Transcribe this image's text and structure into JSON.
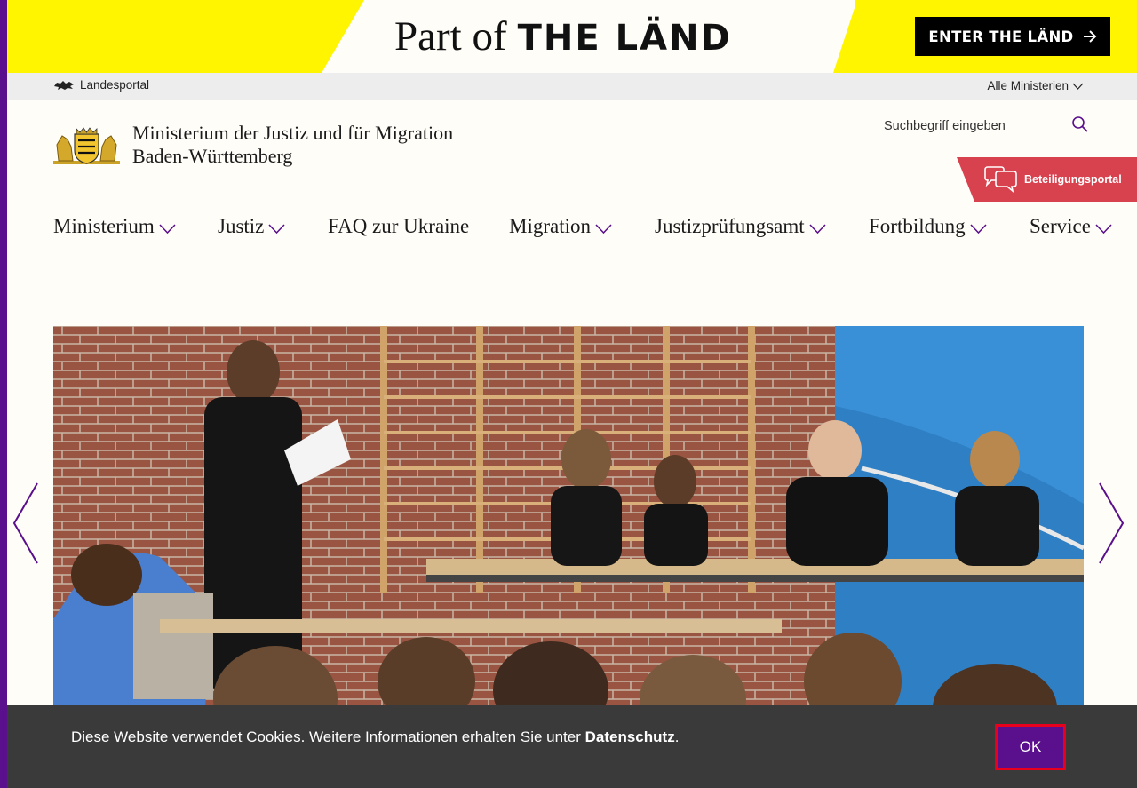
{
  "banner": {
    "part_of": "Part of",
    "the_land": "THE LÄND",
    "enter_label": "ENTER THE LÄND"
  },
  "utility": {
    "landesportal": "Landesportal",
    "ministerien": "Alle Ministerien"
  },
  "header": {
    "title_line1": "Ministerium der Justiz und für Migration",
    "title_line2": "Baden-Württemberg",
    "search_placeholder": "Suchbegriff eingeben",
    "beteiligung_label": "Beteiligungsportal"
  },
  "nav": {
    "items": [
      {
        "label": "Ministerium",
        "has_dropdown": true
      },
      {
        "label": "Justiz",
        "has_dropdown": true
      },
      {
        "label": "FAQ zur Ukraine",
        "has_dropdown": false
      },
      {
        "label": "Migration",
        "has_dropdown": true
      },
      {
        "label": "Justizprüfungsamt",
        "has_dropdown": true
      },
      {
        "label": "Fortbildung",
        "has_dropdown": true
      },
      {
        "label": "Service",
        "has_dropdown": true
      }
    ]
  },
  "cookie": {
    "text": "Diese Website verwendet Cookies. Weitere Informationen erhalten Sie unter ",
    "link": "Datenschutz",
    "suffix": ".",
    "ok_label": "OK"
  },
  "colors": {
    "banner_yellow": "#fff500",
    "accent_purple": "#5a0f8c",
    "beteiligung_red": "#d8424f",
    "cookie_bg": "#3a3a3a"
  },
  "icons": [
    "lion-icon",
    "chevron-down-icon",
    "search-icon",
    "speech-bubbles-icon",
    "arrow-right-icon",
    "chevron-left-icon",
    "chevron-right-icon",
    "coat-of-arms-logo"
  ]
}
